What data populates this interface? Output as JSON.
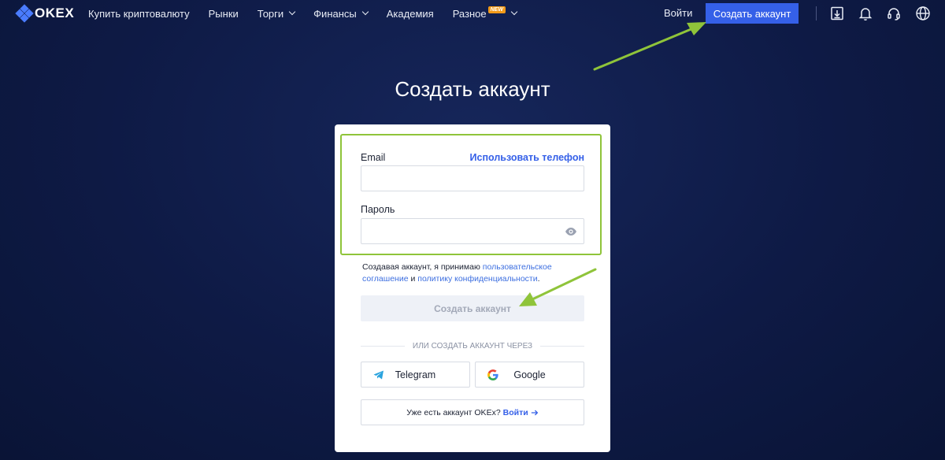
{
  "brand": {
    "logo_text": "OKEX"
  },
  "nav": {
    "items": [
      {
        "label": "Купить криптовалюту",
        "dropdown": false
      },
      {
        "label": "Рынки",
        "dropdown": false
      },
      {
        "label": "Торги",
        "dropdown": true
      },
      {
        "label": "Финансы",
        "dropdown": true
      },
      {
        "label": "Академия",
        "dropdown": false
      },
      {
        "label": "Разное",
        "dropdown": true,
        "badge": "NEW"
      }
    ],
    "login_label": "Войти",
    "signup_label": "Создать аккаунт",
    "icons": [
      "download-icon",
      "bell-icon",
      "headset-icon",
      "globe-icon"
    ]
  },
  "page": {
    "title": "Создать аккаунт"
  },
  "form": {
    "email_label": "Email",
    "use_phone_label": "Использовать телефон",
    "email_value": "",
    "password_label": "Пароль",
    "password_value": "",
    "terms_prefix": "Создавая аккаунт, я принимаю",
    "terms_link": "пользовательское соглашение",
    "terms_and": "и",
    "privacy_link": "политику конфиденциальности",
    "terms_suffix": ".",
    "submit_label": "Создать аккаунт",
    "divider_label": "ИЛИ СОЗДАТЬ АККАУНТ ЧЕРЕЗ",
    "social": [
      {
        "name": "Telegram",
        "icon": "telegram-icon"
      },
      {
        "name": "Google",
        "icon": "google-icon"
      }
    ],
    "have_account_text": "Уже есть аккаунт OKEx?",
    "have_account_login": "Войти"
  },
  "colors": {
    "accent": "#3560e8",
    "highlight": "#8fc43a",
    "background": "#0e1a45"
  }
}
